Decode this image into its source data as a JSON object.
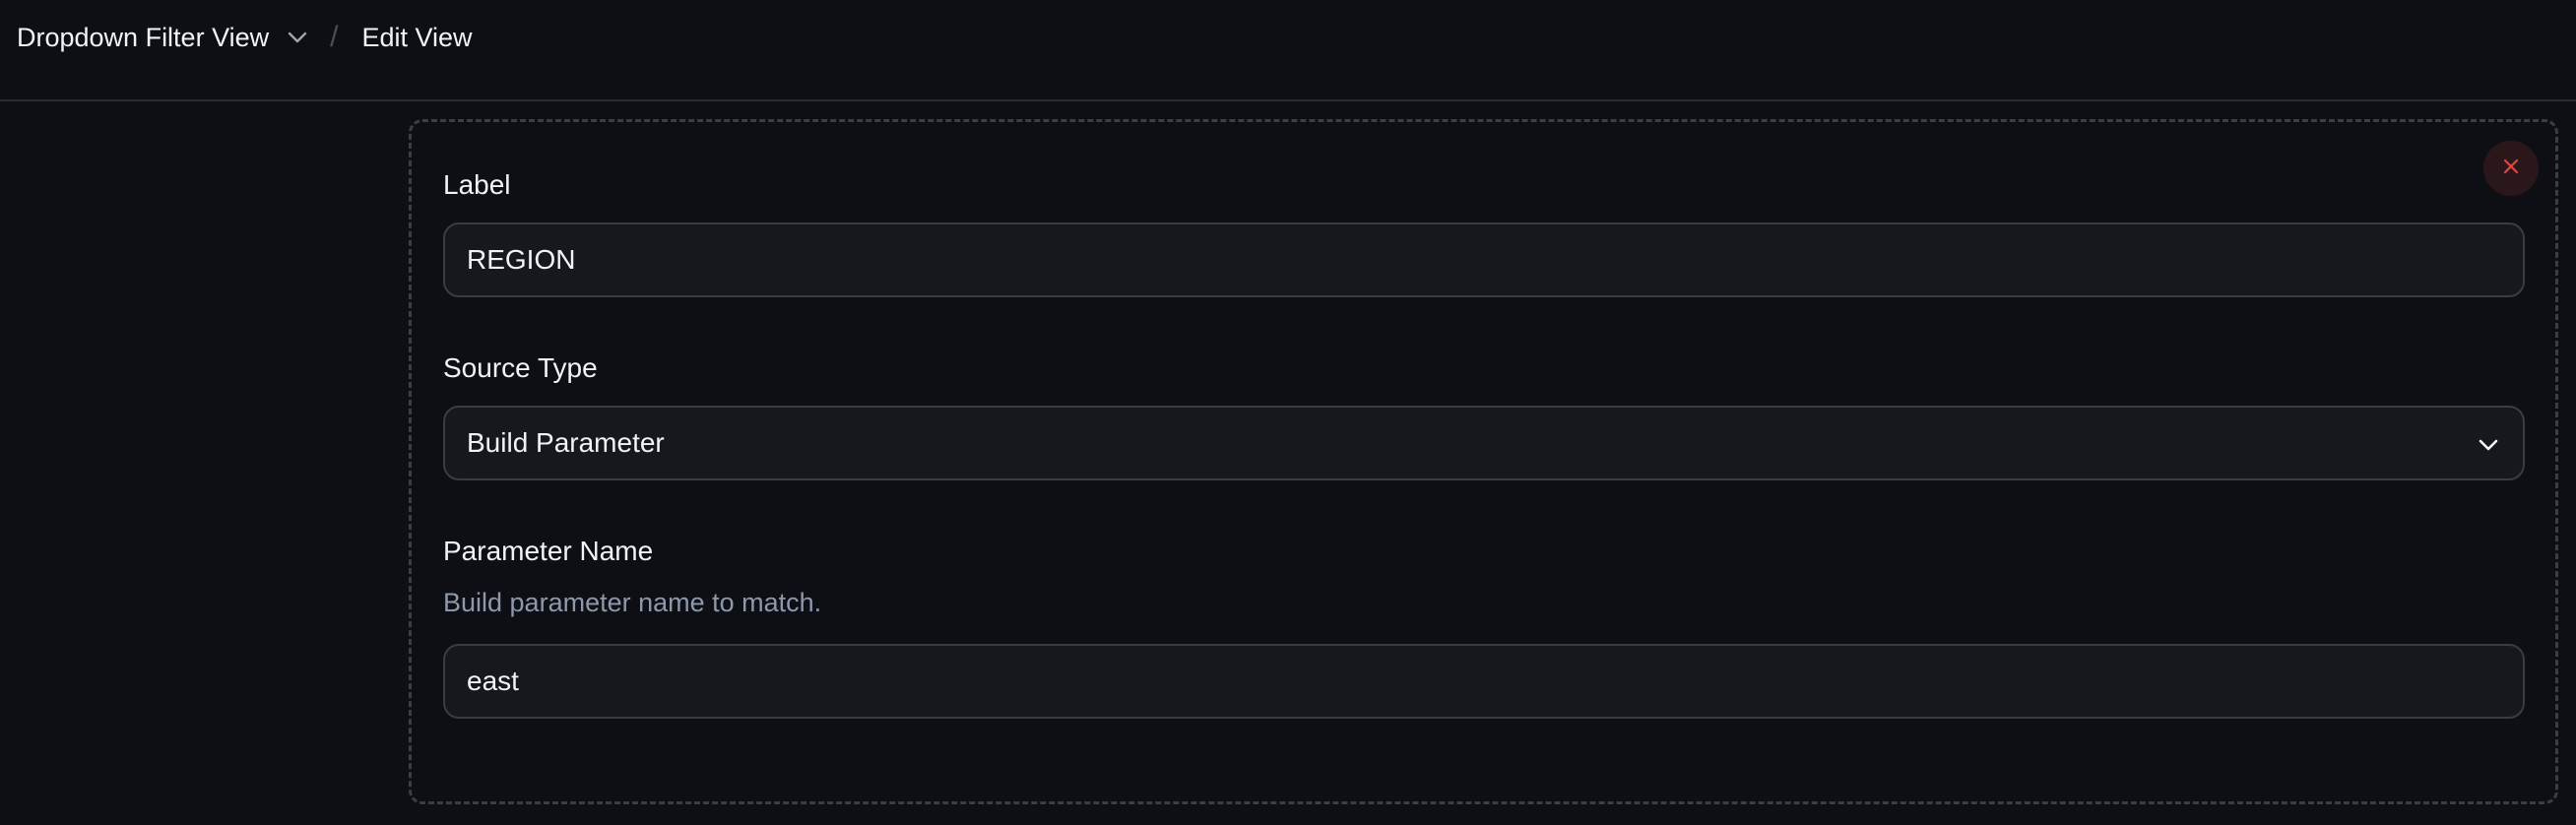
{
  "breadcrumb": {
    "view_name": "Dropdown Filter View",
    "separator": "/",
    "current": "Edit View"
  },
  "form": {
    "label_field": {
      "label": "Label",
      "value": "REGION"
    },
    "source_type_field": {
      "label": "Source Type",
      "value": "Build Parameter"
    },
    "parameter_name_field": {
      "label": "Parameter Name",
      "help": "Build parameter name to match.",
      "value": "east"
    }
  },
  "icons": {
    "breadcrumb_chevron": "chevron-down-icon",
    "select_chevron": "chevron-down-icon",
    "close": "close-icon"
  },
  "colors": {
    "background": "#0e0f14",
    "input_background": "#17181d",
    "close_accent": "#e0483f",
    "help_text": "#8e98ad"
  }
}
